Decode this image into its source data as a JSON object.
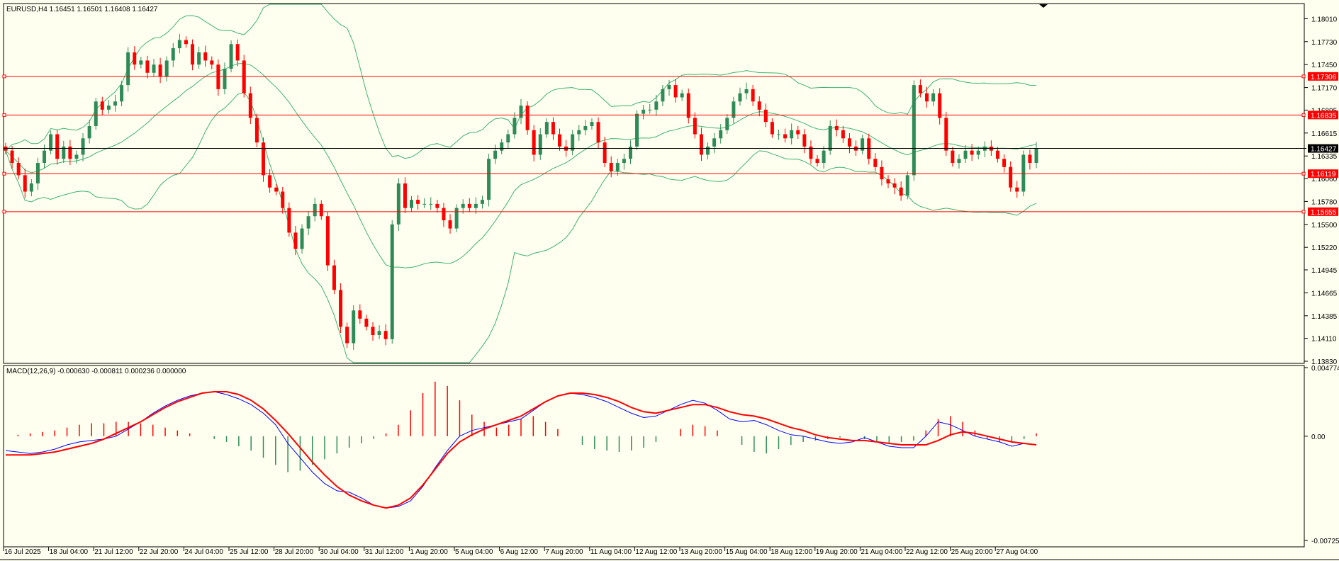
{
  "window": {
    "symbol_header": "EURUSD,H4  1.16451 1.16501 1.16408 1.16427",
    "macd_header": "MACD(12,26,9) -0.000630 -0.000811 0.000236 0.000000"
  },
  "colors": {
    "background": "#fffff0",
    "bull": "#2e8b57",
    "bear": "#ff0000",
    "bands": "#3cb371",
    "level_line": "#ff0000",
    "macd_line": "#0000ff",
    "signal_line": "#ff0000"
  },
  "chart_data": [
    {
      "type": "candlestick",
      "symbol": "EURUSD",
      "timeframe": "H4",
      "ylim": [
        1.1383,
        1.181
      ],
      "yticks": [
        "1.18010",
        "1.17730",
        "1.17450",
        "1.17170",
        "1.16895",
        "1.16615",
        "1.16335",
        "1.16060",
        "1.15780",
        "1.15500",
        "1.15220",
        "1.14945",
        "1.14665",
        "1.14385",
        "1.14110",
        "1.13830"
      ],
      "xticks": [
        "16 Jul 2025",
        "18 Jul 04:00",
        "21 Jul 12:00",
        "22 Jul 20:00",
        "24 Jul 04:00",
        "25 Jul 12:00",
        "28 Jul 20:00",
        "30 Jul 04:00",
        "31 Jul 12:00",
        "1 Aug 20:00",
        "5 Aug 04:00",
        "6 Aug 12:00",
        "7 Aug 20:00",
        "11 Aug 04:00",
        "12 Aug 12:00",
        "13 Aug 20:00",
        "15 Aug 04:00",
        "18 Aug 12:00",
        "19 Aug 20:00",
        "21 Aug 04:00",
        "22 Aug 12:00",
        "25 Aug 20:00",
        "27 Aug 04:00"
      ],
      "current_price": "1.16427",
      "levels": [
        "1.17306",
        "1.16835",
        "1.16119",
        "1.15655"
      ],
      "close": [
        1.164,
        1.1625,
        1.161,
        1.159,
        1.16,
        1.1625,
        1.164,
        1.166,
        1.163,
        1.1645,
        1.163,
        1.1635,
        1.1655,
        1.167,
        1.17,
        1.169,
        1.1695,
        1.17,
        1.172,
        1.176,
        1.1745,
        1.175,
        1.1735,
        1.1745,
        1.173,
        1.175,
        1.1765,
        1.1775,
        1.177,
        1.1745,
        1.176,
        1.175,
        1.1745,
        1.1715,
        1.174,
        1.177,
        1.175,
        1.171,
        1.168,
        1.165,
        1.161,
        1.1595,
        1.159,
        1.157,
        1.154,
        1.152,
        1.1545,
        1.156,
        1.1575,
        1.156,
        1.15,
        1.147,
        1.1425,
        1.1405,
        1.1445,
        1.1435,
        1.1425,
        1.1415,
        1.142,
        1.141,
        1.155,
        1.16,
        1.157,
        1.158,
        1.1575,
        1.1575,
        1.1575,
        1.157,
        1.1555,
        1.1545,
        1.157,
        1.1575,
        1.157,
        1.1575,
        1.158,
        1.163,
        1.164,
        1.165,
        1.166,
        1.168,
        1.1695,
        1.1665,
        1.1635,
        1.166,
        1.1675,
        1.166,
        1.1645,
        1.164,
        1.166,
        1.1665,
        1.167,
        1.1675,
        1.165,
        1.1625,
        1.1615,
        1.1625,
        1.163,
        1.1645,
        1.1685,
        1.169,
        1.169,
        1.17,
        1.1715,
        1.172,
        1.1705,
        1.171,
        1.168,
        1.166,
        1.1635,
        1.1645,
        1.1655,
        1.1665,
        1.168,
        1.17,
        1.171,
        1.1715,
        1.17,
        1.169,
        1.1675,
        1.166,
        1.166,
        1.1655,
        1.1665,
        1.166,
        1.1645,
        1.163,
        1.1625,
        1.164,
        1.167,
        1.1665,
        1.1655,
        1.1645,
        1.164,
        1.1655,
        1.163,
        1.162,
        1.1605,
        1.16,
        1.1595,
        1.1585,
        1.161,
        1.172,
        1.171,
        1.17,
        1.171,
        1.168,
        1.164,
        1.1625,
        1.163,
        1.164,
        1.1635,
        1.164,
        1.1645,
        1.164,
        1.163,
        1.162,
        1.1595,
        1.159,
        1.1635,
        1.1625,
        1.1643
      ],
      "macd": [
        -0.001,
        -0.0011,
        -0.0012,
        -0.0011,
        -0.0009,
        -0.0006,
        -0.0004,
        -0.0003,
        -0.0002,
        0.0,
        0.0005,
        0.001,
        0.0016,
        0.0021,
        0.0025,
        0.0028,
        0.003,
        0.0031,
        0.0029,
        0.0026,
        0.0022,
        0.0016,
        0.0008,
        -0.0005,
        -0.0015,
        -0.0025,
        -0.0033,
        -0.0038,
        -0.0039,
        -0.0043,
        -0.0048,
        -0.005,
        -0.0049,
        -0.0045,
        -0.0035,
        -0.0022,
        -0.001,
        0.0,
        0.0004,
        0.0006,
        0.0008,
        0.001,
        0.0012,
        0.0018,
        0.0024,
        0.0028,
        0.003,
        0.0029,
        0.0027,
        0.0024,
        0.002,
        0.0016,
        0.0013,
        0.0014,
        0.0018,
        0.0022,
        0.0025,
        0.0023,
        0.0018,
        0.0012,
        0.001,
        0.0011,
        0.0008,
        0.0004,
        0.0001,
        0.0,
        -0.0002,
        -0.0004,
        -0.0005,
        -0.0004,
        -0.0001,
        -0.0004,
        -0.0007,
        -0.0008,
        -0.0008,
        0.0,
        0.001,
        0.0008,
        0.0004,
        0.0,
        -0.0002,
        -0.0004,
        -0.0007,
        -0.0005,
        -0.0006
      ],
      "signal": [
        -0.0013,
        -0.0013,
        -0.0013,
        -0.0012,
        -0.0011,
        -0.0009,
        -0.0007,
        -0.0005,
        -0.0002,
        0.0002,
        0.0006,
        0.001,
        0.0015,
        0.002,
        0.0024,
        0.0027,
        0.003,
        0.0031,
        0.0031,
        0.0029,
        0.0025,
        0.0019,
        0.0011,
        0.0002,
        -0.0008,
        -0.0018,
        -0.0027,
        -0.0035,
        -0.0041,
        -0.0045,
        -0.0048,
        -0.005,
        -0.0048,
        -0.0043,
        -0.0034,
        -0.0023,
        -0.0012,
        -0.0004,
        0.0001,
        0.0005,
        0.0008,
        0.0011,
        0.0014,
        0.0019,
        0.0024,
        0.0028,
        0.003,
        0.003,
        0.0029,
        0.0027,
        0.0024,
        0.002,
        0.0017,
        0.0016,
        0.0018,
        0.002,
        0.0022,
        0.0022,
        0.002,
        0.0017,
        0.0015,
        0.0014,
        0.0012,
        0.0009,
        0.0006,
        0.0004,
        0.0001,
        -0.0001,
        -0.0002,
        -0.0003,
        -0.0003,
        -0.0004,
        -0.0005,
        -0.0006,
        -0.0006,
        -0.0006,
        -0.0003,
        0.0001,
        0.0003,
        0.0002,
        0.0,
        -0.0002,
        -0.0004,
        -0.0005,
        -0.0006
      ],
      "histogram": [
        0.0,
        0.0001,
        0.0002,
        0.0003,
        0.0004,
        0.0006,
        0.0008,
        0.0009,
        0.0009,
        0.001,
        0.001,
        0.0009,
        0.0008,
        0.0006,
        0.0004,
        0.0002,
        0.0,
        -0.0002,
        -0.0004,
        -0.0007,
        -0.001,
        -0.0015,
        -0.002,
        -0.0025,
        -0.0024,
        -0.002,
        -0.0016,
        -0.0012,
        -0.0008,
        -0.0005,
        -0.0002,
        0.0002,
        0.0008,
        0.0018,
        0.003,
        0.0038,
        0.0035,
        0.0025,
        0.0015,
        0.001,
        0.0006,
        0.0008,
        0.0012,
        0.0014,
        0.001,
        0.0005,
        0.0,
        -0.0006,
        -0.0009,
        -0.001,
        -0.0011,
        -0.001,
        -0.0008,
        -0.0004,
        0.0,
        0.0005,
        0.0008,
        0.0007,
        0.0004,
        0.0,
        -0.0006,
        -0.0011,
        -0.0012,
        -0.0009,
        -0.0006,
        -0.0004,
        -0.0003,
        -0.0002,
        -0.0001,
        0.0,
        -0.0002,
        -0.0004,
        -0.0005,
        -0.0004,
        -0.0003,
        0.0004,
        0.0012,
        0.0014,
        0.001,
        0.0004,
        -0.0002,
        -0.0004,
        -0.0004,
        -0.0002,
        0.0002
      ],
      "macd_yticks": [
        "0.004774",
        "0.00",
        "-0.007257"
      ],
      "macd_ylim": [
        -0.007257,
        0.004774
      ]
    }
  ]
}
